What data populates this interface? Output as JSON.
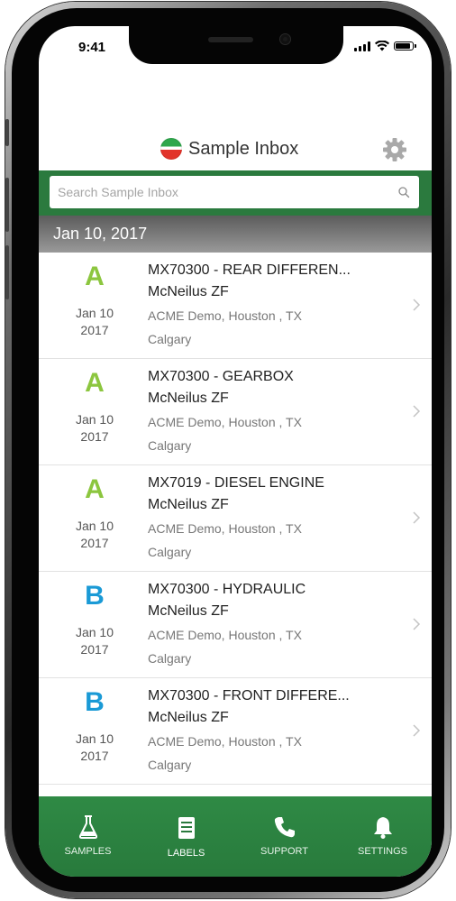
{
  "status_bar": {
    "time": "9:41"
  },
  "header": {
    "title": "Sample Inbox",
    "logo_icon": "brand-logo-icon",
    "settings_icon": "gear-icon"
  },
  "search": {
    "placeholder": "Search Sample Inbox",
    "value": ""
  },
  "date_section": {
    "label": "Jan 10, 2017"
  },
  "samples": [
    {
      "grade": "A",
      "grade_color": "#8cc63f",
      "date_line1": "Jan 10",
      "date_line2": "2017",
      "title": "MX70300 - REAR DIFFEREN...",
      "customer": "McNeilus ZF",
      "location": "ACME Demo, Houston , TX",
      "site": "Calgary"
    },
    {
      "grade": "A",
      "grade_color": "#8cc63f",
      "date_line1": "Jan 10",
      "date_line2": "2017",
      "title": "MX70300 - GEARBOX",
      "customer": "McNeilus ZF",
      "location": "ACME Demo, Houston , TX",
      "site": "Calgary"
    },
    {
      "grade": "A",
      "grade_color": "#8cc63f",
      "date_line1": "Jan 10",
      "date_line2": "2017",
      "title": "MX7019 - DIESEL ENGINE",
      "customer": "McNeilus ZF",
      "location": "ACME Demo, Houston , TX",
      "site": "Calgary"
    },
    {
      "grade": "B",
      "grade_color": "#1a9ad6",
      "date_line1": "Jan 10",
      "date_line2": "2017",
      "title": "MX70300 - HYDRAULIC",
      "customer": "McNeilus ZF",
      "location": "ACME Demo, Houston , TX",
      "site": "Calgary"
    },
    {
      "grade": "B",
      "grade_color": "#1a9ad6",
      "date_line1": "Jan 10",
      "date_line2": "2017",
      "title": "MX70300 - FRONT DIFFERE...",
      "customer": "McNeilus ZF",
      "location": "ACME Demo, Houston , TX",
      "site": "Calgary"
    }
  ],
  "tabbar": {
    "tabs": [
      {
        "label": "SAMPLES",
        "icon": "flask-icon"
      },
      {
        "label": "LABELS",
        "icon": "labels-icon",
        "active": true
      },
      {
        "label": "SUPPORT",
        "icon": "phone-icon"
      },
      {
        "label": "SETTINGS",
        "icon": "bell-icon"
      }
    ]
  },
  "colors": {
    "brand_green": "#2b7a3e",
    "grade_a": "#8cc63f",
    "grade_b": "#1a9ad6"
  }
}
